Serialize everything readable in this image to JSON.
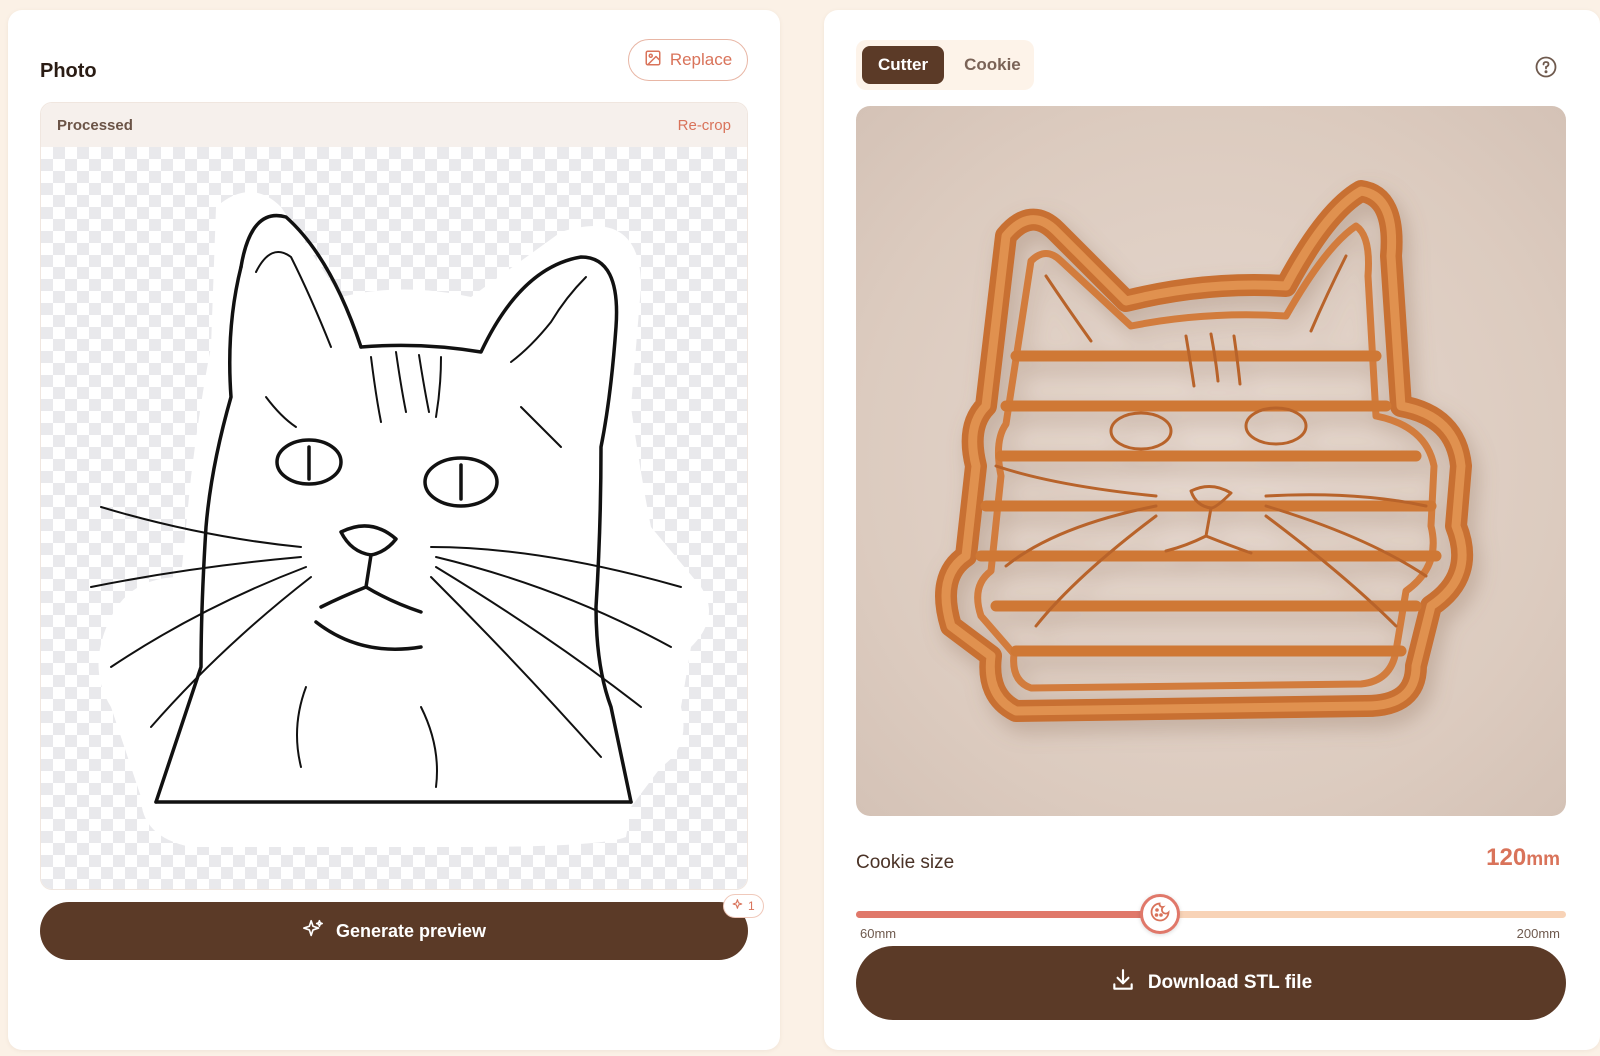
{
  "colors": {
    "page_bg": "#fbf1e6",
    "primary_brown": "#5b3a27",
    "accent_coral": "#d9735a",
    "cutter_orange": "#d27c3c",
    "viewer_bg": "#dccbbf"
  },
  "photo_panel": {
    "title": "Photo",
    "replace_button": {
      "label": "Replace",
      "icon": "image-icon"
    },
    "image_card": {
      "status_label": "Processed",
      "recrop_link": "Re-crop",
      "image_description_icon": "cat-line-art"
    },
    "generate_button": {
      "label": "Generate preview",
      "icon": "sparkle-icon"
    },
    "credit_badge": {
      "count": "1",
      "icon": "sparkle-small-icon"
    }
  },
  "preview_panel": {
    "tabs": [
      {
        "label": "Cutter",
        "active": true
      },
      {
        "label": "Cookie",
        "active": false
      }
    ],
    "help_icon": "help-circle-icon",
    "size_control": {
      "label": "Cookie size",
      "value": "120",
      "unit": "mm",
      "min_label": "60mm",
      "max_label": "200mm",
      "min": 60,
      "max": 200,
      "current": 120,
      "thumb_icon": "cookie-icon"
    },
    "download_button": {
      "label": "Download STL file",
      "icon": "download-icon"
    }
  }
}
